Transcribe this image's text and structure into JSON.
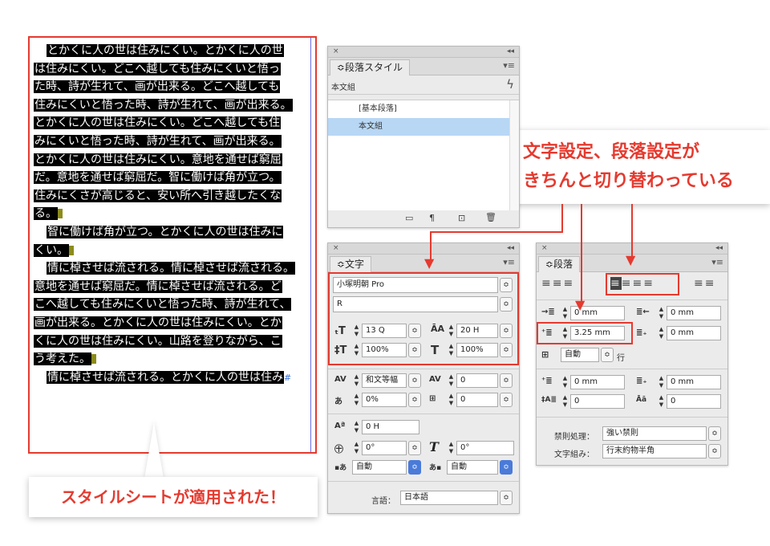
{
  "text_frame": {
    "lines": [
      {
        "text": "とかくに人の世は住みにくい。とかくに人の世",
        "indent": true
      },
      {
        "text": "は住みにくい。どこへ越しても住みにくいと悟っ"
      },
      {
        "text": "た時、詩が生れて、画が出来る。どこへ越しても"
      },
      {
        "text": "住みにくいと悟った時、詩が生れて、画が出来る。"
      },
      {
        "text": "とかくに人の世は住みにくい。どこへ越しても住"
      },
      {
        "text": "みにくいと悟った時、詩が生れて、画が出来る。"
      },
      {
        "text": "とかくに人の世は住みにくい。意地を通せば窮屈"
      },
      {
        "text": "だ。意地を通せば窮屈だ。智に働けば角が立つ。"
      },
      {
        "text": "住みにくさが高じると、安い所へ引き越したくな"
      },
      {
        "text": "る。",
        "end": true
      },
      {
        "text": "智に働けば角が立つ。とかくに人の世は住みに",
        "indent": true
      },
      {
        "text": "くい。",
        "end": true
      },
      {
        "text": "情に棹させば流される。情に棹させば流される。",
        "indent": true
      },
      {
        "text": "意地を通せば窮屈だ。情に棹させば流される。ど"
      },
      {
        "text": "こへ越しても住みにくいと悟った時、詩が生れて、"
      },
      {
        "text": "画が出来る。とかくに人の世は住みにくい。とか"
      },
      {
        "text": "くに人の世は住みにくい。山路を登りながら、こ"
      },
      {
        "text": "う考えた。",
        "end": true
      },
      {
        "text": "情に棹させば流される。とかくに人の世は住み",
        "indent": true,
        "overflow": true
      }
    ]
  },
  "callouts": {
    "applied": "スタイルシートが適用された！",
    "switching_line1": "文字設定、段落設定が",
    "switching_line2": "きちんと切り替わっている"
  },
  "para_style_panel": {
    "close": "×",
    "collapse": "◂◂",
    "tab": "≎段落スタイル",
    "menu": "▾≡",
    "current": "本文組",
    "lightning": "ϟ",
    "items": [
      "[基本段落]",
      "本文組"
    ],
    "selected_index": 1
  },
  "char_panel": {
    "close": "×",
    "collapse": "◂◂",
    "tab": "≎文字",
    "menu": "▾≡",
    "font_family": "小塚明朝 Pro",
    "font_style": "R",
    "size": "13 Q",
    "leading": "20 H",
    "vscale": "100%",
    "hscale": "100%",
    "kerning": "和文等幅",
    "tracking": "0",
    "tsume": "0%",
    "aki": "0",
    "baseline": "0 H",
    "rotate": "0°",
    "skew": "0°",
    "aki_before": "自動",
    "aki_after": "自動",
    "language_label": "言語：",
    "language": "日本語"
  },
  "para_panel": {
    "close": "×",
    "collapse": "◂◂",
    "tab": "≎段落",
    "menu": "▾≡",
    "left_indent": "0 mm",
    "right_indent": "0 mm",
    "first_indent": "3.25 mm",
    "last_indent": "0 mm",
    "drop_lines": "自動",
    "drop_unit": "行",
    "space_before": "0 mm",
    "space_after": "0 mm",
    "drop_cap_lines": "0",
    "drop_cap_chars": "0",
    "kinsoku_label": "禁則処理：",
    "kinsoku": "強い禁則",
    "mojikumi_label": "文字組み：",
    "mojikumi": "行末約物半角"
  },
  "colors": {
    "accent_red": "#e53a2f",
    "selection_blue": "#b8d7f5"
  }
}
